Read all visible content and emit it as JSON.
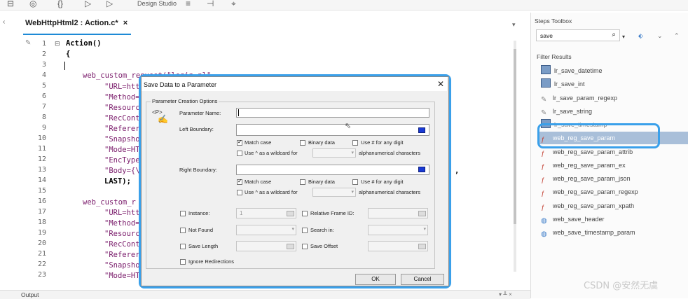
{
  "toolbar": {
    "design_studio": "Design Studio"
  },
  "editor": {
    "tab_title": "WebHttpHtml2 : Action.c*",
    "tab_close": "×",
    "line_numbers": [
      "1",
      "2",
      "3",
      "4",
      "5",
      "6",
      "7",
      "8",
      "9",
      "10",
      "11",
      "12",
      "13",
      "14",
      "15",
      "16",
      "17",
      "18",
      "19",
      "20",
      "21",
      "22",
      "23"
    ],
    "code": {
      "l1": "Action()",
      "l2": "{",
      "l4": "web_custom_request(\"login.pl\",",
      "l5": "\"URL=http",
      "l6": "\"Method=",
      "l7": "\"Resourc",
      "l8": "\"RecCont",
      "l9": "\"Referer",
      "l10": "\"Snapsho",
      "l11": "\"Mode=HT",
      "l12": "\"EncType",
      "l13": "\"Body={\\",
      "l14": "LAST);",
      "l16": "web_custom_r",
      "l17": "\"URL=http",
      "l18": "\"Method=",
      "l19": "\"Resourc",
      "l20": "\"RecCont",
      "l21": "\"Referer",
      "l22": "\"Snapsho",
      "l23": "\"Mode=HT",
      "l13_tail": ","
    }
  },
  "output_label": "Output",
  "panel_controls": "▾ ╨ ×",
  "right_panel": {
    "title": "Steps Toolbox",
    "search_value": "save",
    "filter_results": "Filter Results",
    "items": [
      {
        "label": "lr_save_datetime",
        "icon": "calendar-icon"
      },
      {
        "label": "lr_save_int",
        "icon": "calendar-icon"
      },
      {
        "label": "lr_save_param_regexp",
        "icon": "pen-icon"
      },
      {
        "label": "lr_save_string",
        "icon": "pen-icon"
      },
      {
        "label": "lr_save_timestamp",
        "icon": "calendar-icon"
      },
      {
        "label": "web_reg_save_param",
        "icon": "function-icon"
      },
      {
        "label": "web_reg_save_param_attrib",
        "icon": "function-icon"
      },
      {
        "label": "web_reg_save_param_ex",
        "icon": "function-icon"
      },
      {
        "label": "web_reg_save_param_json",
        "icon": "function-icon"
      },
      {
        "label": "web_reg_save_param_regexp",
        "icon": "function-icon"
      },
      {
        "label": "web_reg_save_param_xpath",
        "icon": "function-icon"
      },
      {
        "label": "web_save_header",
        "icon": "globe-icon"
      },
      {
        "label": "web_save_timestamp_param",
        "icon": "globe-icon"
      }
    ]
  },
  "dialog": {
    "title": "Save Data to a Parameter",
    "group_label": "Parameter Creation Options",
    "param_icon_text": "<P>",
    "parameter_name_label": "Parameter Name:",
    "parameter_name_value": "",
    "left_boundary_label": "Left Boundary:",
    "right_boundary_label": "Right Boundary:",
    "match_case": "Match case",
    "binary_data": "Binary data",
    "use_hash": "Use # for any digit",
    "use_caret": "Use ^ as a wildcard for",
    "alnum": "alphanumerical characters",
    "instance_label": "Instance:",
    "instance_value": "1",
    "relative_frame": "Relative Frame ID:",
    "not_found": "Not Found",
    "search_in": "Search in:",
    "save_length": "Save Length",
    "save_offset": "Save Offset",
    "ignore_redirections": "Ignore Redirections",
    "ok": "OK",
    "cancel": "Cancel"
  },
  "watermark": "CSDN @安然无虞",
  "colors": {
    "accent": "#3aa0ea",
    "selected_row": "#a9bfd9"
  }
}
